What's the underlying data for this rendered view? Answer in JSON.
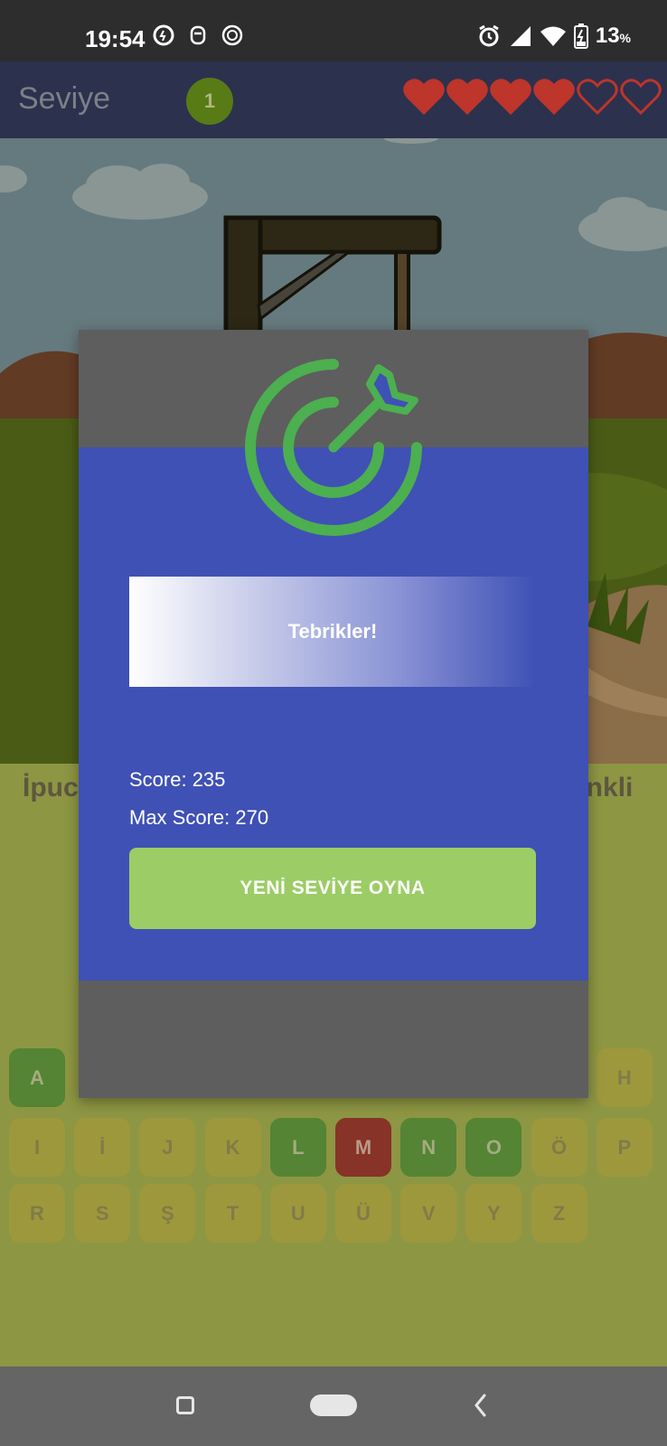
{
  "status": {
    "time": "19:54",
    "battery": "13",
    "battery_unit": "%"
  },
  "appbar": {
    "title": "Seviye",
    "level": "1",
    "hearts_total": 6,
    "hearts_filled": 4
  },
  "hint": {
    "left": "İpuc",
    "right": "enkli"
  },
  "dialog": {
    "message": "Tebrikler!",
    "score": "Score: 235",
    "max_score": "Max Score: 270",
    "next_button": "YENİ SEVİYE OYNA"
  },
  "keyboard": {
    "row1": [
      {
        "letter": "A",
        "state": "correct"
      },
      {
        "letter": "H",
        "state": "normal"
      }
    ],
    "row2": [
      {
        "letter": "I",
        "state": "normal"
      },
      {
        "letter": "İ",
        "state": "normal"
      },
      {
        "letter": "J",
        "state": "normal"
      },
      {
        "letter": "K",
        "state": "normal"
      },
      {
        "letter": "L",
        "state": "correct"
      },
      {
        "letter": "M",
        "state": "wrong"
      },
      {
        "letter": "N",
        "state": "correct"
      },
      {
        "letter": "O",
        "state": "correct"
      },
      {
        "letter": "Ö",
        "state": "normal"
      },
      {
        "letter": "P",
        "state": "normal"
      }
    ],
    "row3": [
      {
        "letter": "R",
        "state": "normal"
      },
      {
        "letter": "S",
        "state": "normal"
      },
      {
        "letter": "Ş",
        "state": "normal"
      },
      {
        "letter": "T",
        "state": "normal"
      },
      {
        "letter": "U",
        "state": "normal"
      },
      {
        "letter": "Ü",
        "state": "normal"
      },
      {
        "letter": "V",
        "state": "normal"
      },
      {
        "letter": "Y",
        "state": "normal"
      },
      {
        "letter": "Z",
        "state": "normal"
      }
    ]
  },
  "colors": {
    "dialog_blue": "#3f51b5",
    "button_green": "#9ccc65",
    "icon_green": "#4caf50",
    "heart_red": "#c62828"
  }
}
